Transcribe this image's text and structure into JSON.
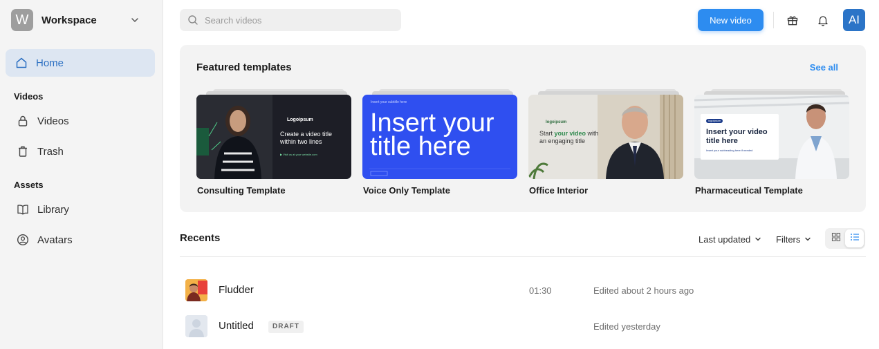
{
  "sidebar": {
    "workspace_initial": "W",
    "workspace_name": "Workspace",
    "home_label": "Home",
    "section_videos": "Videos",
    "videos_label": "Videos",
    "trash_label": "Trash",
    "section_assets": "Assets",
    "library_label": "Library",
    "avatars_label": "Avatars"
  },
  "topbar": {
    "search_placeholder": "Search videos",
    "new_video_label": "New video",
    "user_initials": "AI"
  },
  "featured": {
    "title": "Featured templates",
    "see_all": "See all",
    "templates": [
      {
        "name": "Consulting Template",
        "logo": "Logoipsum",
        "headline": "Create a video title within two lines",
        "footer": "▶ Visit us at your website.com"
      },
      {
        "name": "Voice Only Template",
        "small": "Insert your subtitle here",
        "headline": "Insert your title here"
      },
      {
        "name": "Office Interior",
        "logo": "logoipsum",
        "headline_pre": "Start ",
        "headline_accent": "your video",
        "headline_post": " with an engaging title"
      },
      {
        "name": "Pharmaceutical Template",
        "logo": "logoipsum",
        "headline": "Insert your video title here",
        "sub": "Insert your subheading here if needed"
      }
    ]
  },
  "recents": {
    "title": "Recents",
    "sort_label": "Last updated",
    "filters_label": "Filters",
    "rows": [
      {
        "name": "Fludder",
        "duration": "01:30",
        "edited": "Edited about 2 hours ago"
      },
      {
        "name": "Untitled",
        "badge": "DRAFT",
        "edited": "Edited yesterday"
      }
    ]
  },
  "colors": {
    "accent": "#2d8cf0",
    "home_active_bg": "#dde6f2",
    "voice_template_blue": "#2f4ff0"
  }
}
